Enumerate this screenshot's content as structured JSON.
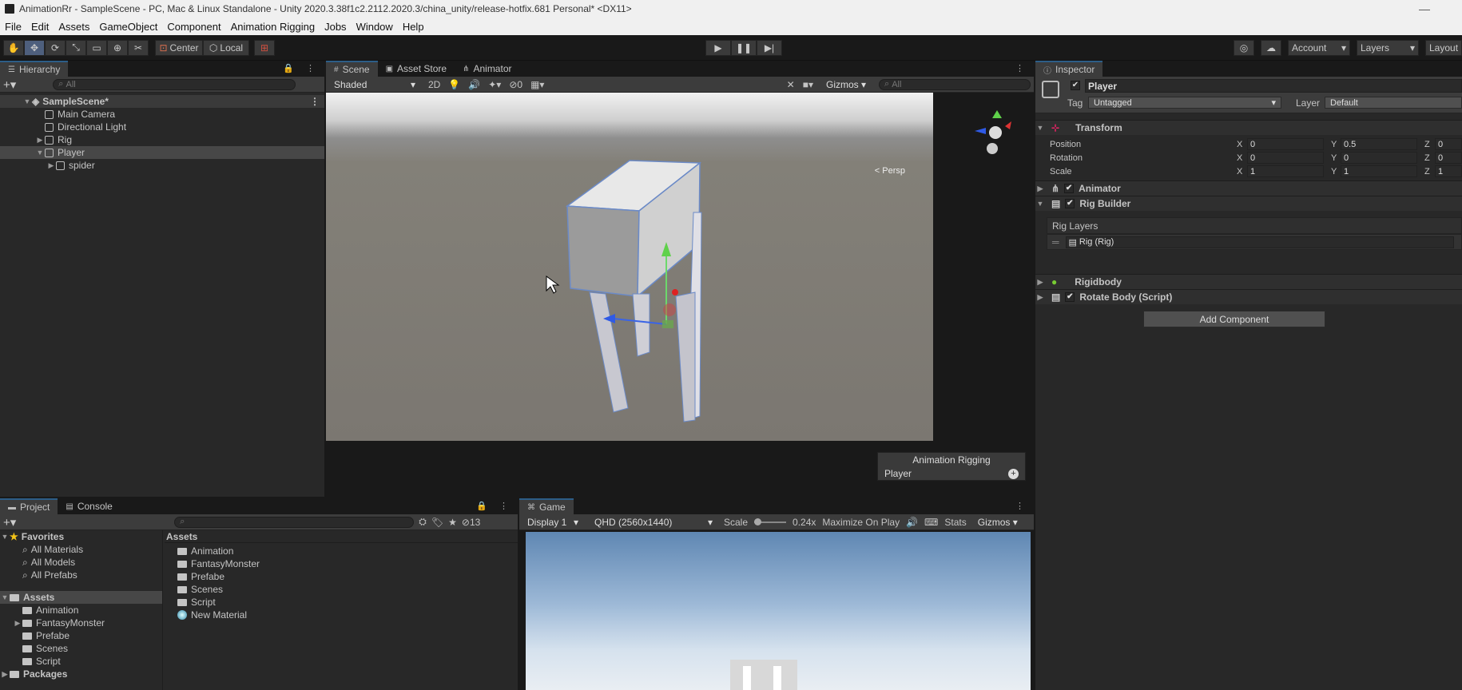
{
  "window": {
    "title": "AnimationRr - SampleScene - PC, Mac & Linux Standalone - Unity 2020.3.38f1c2.2112.2020.3/china_unity/release-hotfix.681 Personal* <DX11>"
  },
  "menu": [
    "File",
    "Edit",
    "Assets",
    "GameObject",
    "Component",
    "Animation Rigging",
    "Jobs",
    "Window",
    "Help"
  ],
  "toolbar": {
    "pivot": "Center",
    "space": "Local",
    "account": "Account",
    "layers": "Layers",
    "layout": "Layout"
  },
  "hierarchy": {
    "tab": "Hierarchy",
    "search_placeholder": "All",
    "scene": "SampleScene*",
    "items": [
      {
        "label": "Main Camera"
      },
      {
        "label": "Directional Light"
      },
      {
        "label": "Rig"
      },
      {
        "label": "Player"
      },
      {
        "label": "spider"
      }
    ]
  },
  "scene": {
    "tabs": [
      "Scene",
      "Asset Store",
      "Animator"
    ],
    "shading": "Shaded",
    "mode2d": "2D",
    "hidden_count": "0",
    "gizmos": "Gizmos",
    "search_placeholder": "All",
    "persp": "< Persp",
    "overlay_title": "Animation Rigging",
    "overlay_item": "Player"
  },
  "project": {
    "tabs": [
      "Project",
      "Console"
    ],
    "hidden_count": "13",
    "favorites_label": "Favorites",
    "favorites": [
      "All Materials",
      "All Models",
      "All Prefabs"
    ],
    "assets_label": "Assets",
    "asset_folders": [
      "Animation",
      "FantasyMonster",
      "Prefabe",
      "Scenes",
      "Script"
    ],
    "packages_label": "Packages",
    "breadcrumb": "Assets",
    "files": [
      "Animation",
      "FantasyMonster",
      "Prefabe",
      "Scenes",
      "Script",
      "New Material"
    ]
  },
  "game": {
    "tab": "Game",
    "display": "Display 1",
    "resolution": "QHD (2560x1440)",
    "scale_label": "Scale",
    "scale_value": "0.24x",
    "maximize": "Maximize On Play",
    "stats": "Stats",
    "gizmos": "Gizmos"
  },
  "inspector": {
    "tab": "Inspector",
    "object_name": "Player",
    "tag_label": "Tag",
    "tag_value": "Untagged",
    "layer_label": "Layer",
    "layer_value": "Default",
    "transform": {
      "title": "Transform",
      "rows": [
        {
          "label": "Position",
          "x": "0",
          "y": "0.5",
          "z": "0"
        },
        {
          "label": "Rotation",
          "x": "0",
          "y": "0",
          "z": "0"
        },
        {
          "label": "Scale",
          "x": "1",
          "y": "1",
          "z": "1"
        }
      ]
    },
    "animator": "Animator",
    "rig_builder": "Rig Builder",
    "rig_layers_label": "Rig Layers",
    "rig_layer_item": "Rig (Rig)",
    "rigidbody": "Rigidbody",
    "rotate_body": "Rotate Body (Script)",
    "add_component": "Add Component",
    "axis": {
      "x": "X",
      "y": "Y",
      "z": "Z"
    }
  }
}
